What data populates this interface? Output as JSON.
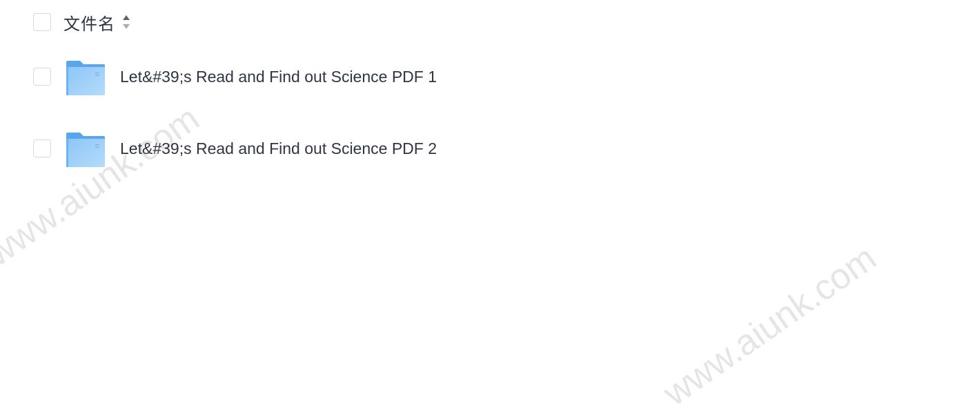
{
  "header": {
    "column_label": "文件名",
    "sort_icon": "sort-updown-icon"
  },
  "files": [
    {
      "icon": "folder-icon",
      "name": "Let&#39;s Read and Find out Science PDF 1"
    },
    {
      "icon": "folder-icon",
      "name": "Let&#39;s Read and Find out Science PDF 2"
    }
  ],
  "watermark": "www.aiunk.com",
  "colors": {
    "text": "#2f3547",
    "checkbox_border": "#d6d9df",
    "folder": "#6fb3f2",
    "folder_light": "#a8d3fb",
    "watermark": "rgba(0,0,0,0.10)"
  }
}
